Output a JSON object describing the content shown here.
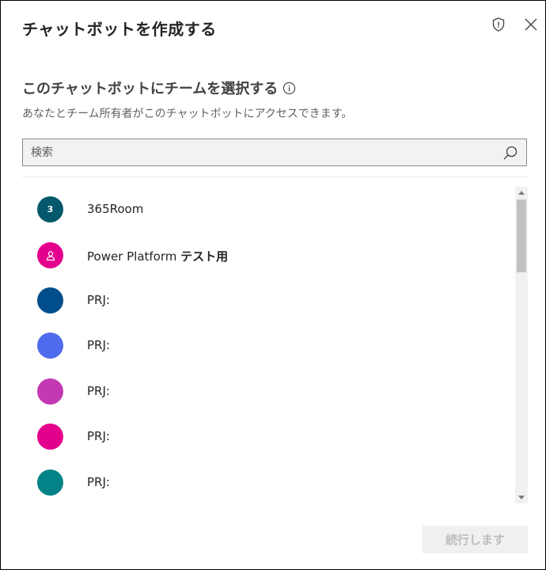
{
  "dialog": {
    "title": "チャットボットを作成する",
    "subtitle": "このチャットボットにチームを選択する",
    "description": "あなたとチーム所有者がこのチャットボットにアクセスできます。"
  },
  "search": {
    "placeholder": "検索"
  },
  "teams": [
    {
      "initial": "3",
      "name": "365Room",
      "name_bold": "",
      "color": "#03586b"
    },
    {
      "initial": "",
      "name": "Power Platform ",
      "name_bold": "テスト用",
      "color": "#e3008c"
    },
    {
      "initial": "",
      "name": "PRJ:",
      "name_bold": "",
      "color": "#004e8c"
    },
    {
      "initial": "",
      "name": "PRJ:",
      "name_bold": "",
      "color": "#4f6bed"
    },
    {
      "initial": "",
      "name": "PRJ:",
      "name_bold": "",
      "color": "#c239b3"
    },
    {
      "initial": "",
      "name": "PRJ:",
      "name_bold": "",
      "color": "#e3008c"
    },
    {
      "initial": "",
      "name": "PRJ:",
      "name_bold": "",
      "color": "#038387"
    }
  ],
  "footer": {
    "continue_label": "続行します"
  },
  "icons": {
    "shield": "shield-icon",
    "close": "close-icon",
    "info": "info-icon",
    "search": "search-icon",
    "person": "person-icon"
  }
}
